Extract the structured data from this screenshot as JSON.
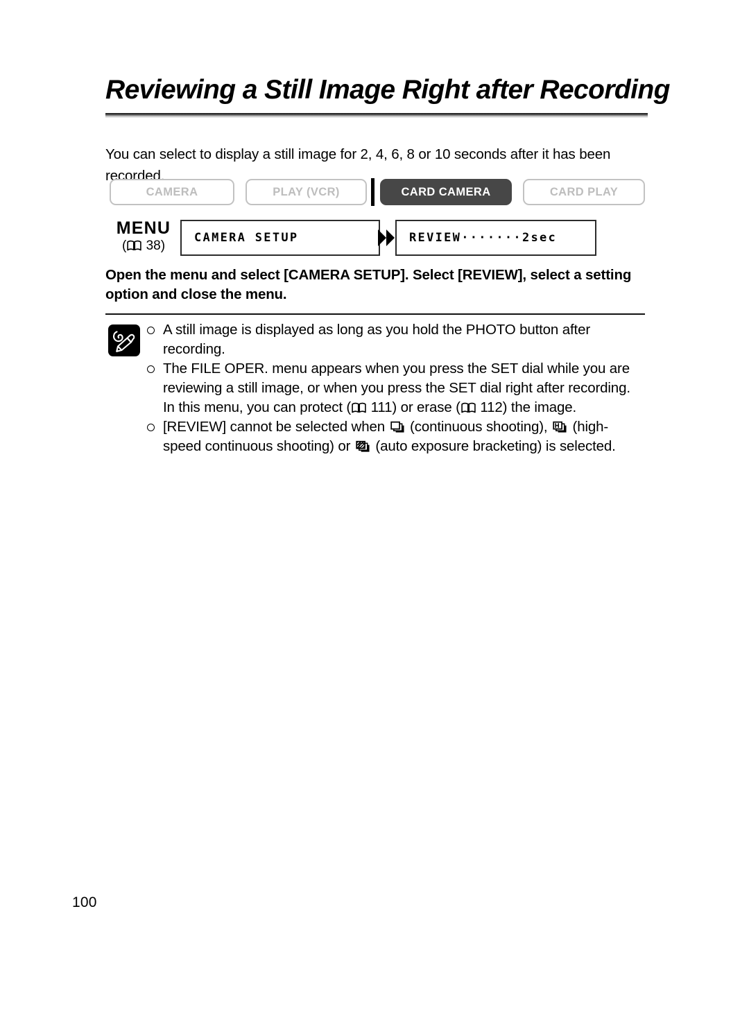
{
  "document": {
    "title": "Reviewing a Still Image Right after Recording",
    "intro": "You can select to display a still image for 2, 4, 6, 8 or 10 seconds after it has been recorded.",
    "page_number": "100"
  },
  "mode_buttons": {
    "items": [
      {
        "label": "CAMERA",
        "active": false
      },
      {
        "label": "PLAY (VCR)",
        "active": false
      },
      {
        "label": "CARD CAMERA",
        "active": true
      },
      {
        "label": "CARD PLAY",
        "active": false
      }
    ],
    "active_color": "#474747",
    "inactive_color": "#bdbdbd"
  },
  "menu_path": {
    "menu_word": "MENU",
    "reference_open": "(",
    "reference_page": "38",
    "reference_close": ")",
    "steps": [
      {
        "text": "CAMERA SETUP"
      },
      {
        "text": "REVIEW·······2sec"
      }
    ],
    "arrow_icon": "double-right-arrow-icon"
  },
  "instruction": {
    "line1": "Open the menu and select [CAMERA SETUP]. Select [REVIEW], select a",
    "line2": "setting option and close the menu."
  },
  "notes": {
    "icon": "notes-pencil-icon",
    "items": [
      {
        "parts": [
          {
            "type": "text",
            "value": "A still image is displayed as long as you hold the PHOTO button after recording."
          }
        ]
      },
      {
        "parts": [
          {
            "type": "text",
            "value": "The FILE OPER. menu appears when you press the SET dial while you are reviewing a still image, or when you press the SET dial right after recording. In this menu, you can protect ("
          },
          {
            "type": "icon",
            "value": "book-icon"
          },
          {
            "type": "text",
            "value": " 111) or erase ("
          },
          {
            "type": "icon",
            "value": "book-icon"
          },
          {
            "type": "text",
            "value": " 112) the image."
          }
        ]
      },
      {
        "parts": [
          {
            "type": "text",
            "value": "[REVIEW] cannot be selected when "
          },
          {
            "type": "icon",
            "value": "continuous-shooting-icon"
          },
          {
            "type": "text",
            "value": " (continuous shooting), "
          },
          {
            "type": "icon",
            "value": "high-speed-continuous-shooting-icon"
          },
          {
            "type": "text",
            "value": " (high-speed continuous shooting) or "
          },
          {
            "type": "icon",
            "value": "auto-exposure-bracketing-icon"
          },
          {
            "type": "text",
            "value": " (auto exposure bracketing) is selected."
          }
        ]
      }
    ]
  }
}
